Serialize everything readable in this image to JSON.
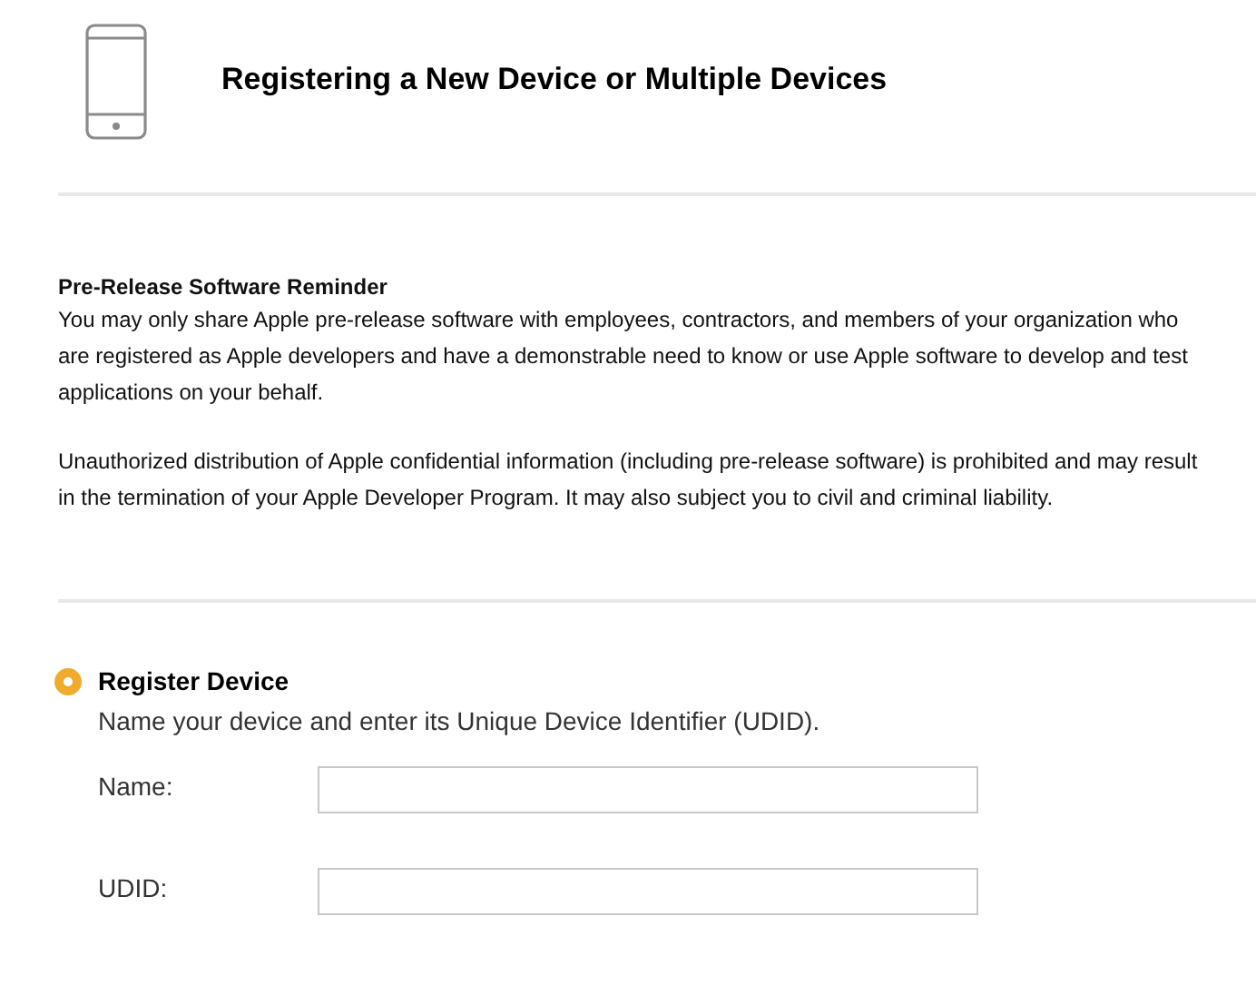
{
  "header": {
    "title": "Registering a New Device or Multiple Devices"
  },
  "reminder": {
    "heading": "Pre-Release Software Reminder",
    "paragraphs": [
      "You may only share Apple pre-release software with employees, contractors, and members of your organization who are registered as Apple developers and have a demonstrable need to know or use Apple software to develop and test applications on your behalf.",
      "Unauthorized distribution of Apple confidential information (including pre-release software) is prohibited and may result in the termination of your Apple Developer Program. It may also subject you to civil and criminal liability."
    ]
  },
  "option": {
    "label": "Register Device",
    "selected": true,
    "description": "Name your device and enter its Unique Device Identifier (UDID).",
    "fields": [
      {
        "label": "Name:"
      },
      {
        "label": "UDID:"
      }
    ]
  }
}
